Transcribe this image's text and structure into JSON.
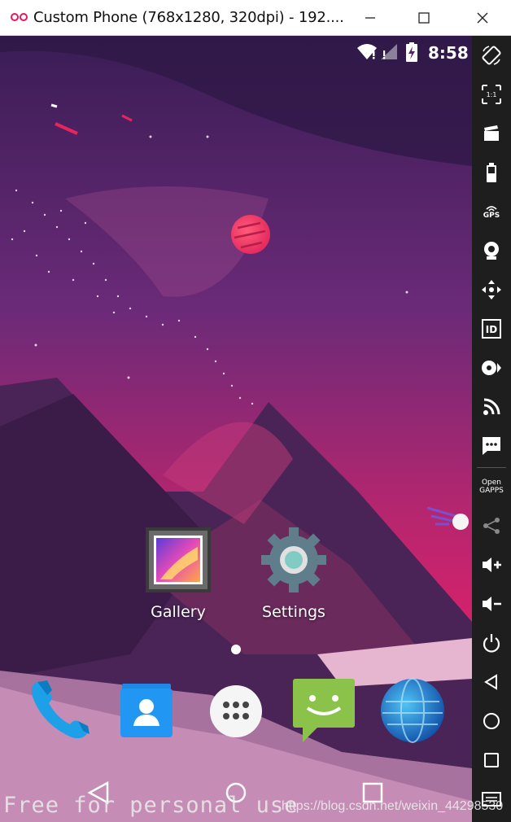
{
  "window": {
    "title": "Custom Phone (768x1280, 320dpi) - 192....",
    "controls": {
      "minimize": "minimize-icon",
      "maximize": "maximize-icon",
      "close": "close-icon"
    }
  },
  "statusbar": {
    "time": "8:58",
    "icons": [
      "wifi-icon",
      "signal-icon",
      "battery-charging-icon"
    ]
  },
  "home": {
    "apps": [
      {
        "label": "Gallery",
        "icon": "gallery-icon"
      },
      {
        "label": "Settings",
        "icon": "settings-gear-icon"
      }
    ],
    "dock": [
      "phone-icon",
      "contacts-icon",
      "app-drawer-icon",
      "messaging-icon",
      "browser-icon"
    ]
  },
  "navbar": [
    "back-icon",
    "home-icon",
    "recents-icon"
  ],
  "toolbar": {
    "tools": [
      "rotate-icon",
      "pixel-perfect-icon",
      "screencast-icon",
      "battery-icon",
      "gps-icon",
      "camera-icon",
      "dpad-icon",
      "device-id-icon",
      "media-icon",
      "network-icon",
      "sms-icon",
      "opengapps-icon",
      "share-icon",
      "volume-up-icon",
      "volume-down-icon",
      "power-icon",
      "back-icon",
      "home-icon",
      "recents-icon",
      "menu-icon"
    ],
    "gps_label": "GPS",
    "gapps_label_1": "Open",
    "gapps_label_2": "GAPPS",
    "pixel_label": "1:1",
    "id_label": "ID"
  },
  "watermark": {
    "text": "Free for personal use",
    "url": "https://blog.csdn.net/weixin_44298530"
  },
  "colors": {
    "accent": "#e91e63",
    "sky_top": "#3a1d55",
    "sky_bottom": "#e0206a",
    "toolbar": "#1e1e1e"
  }
}
